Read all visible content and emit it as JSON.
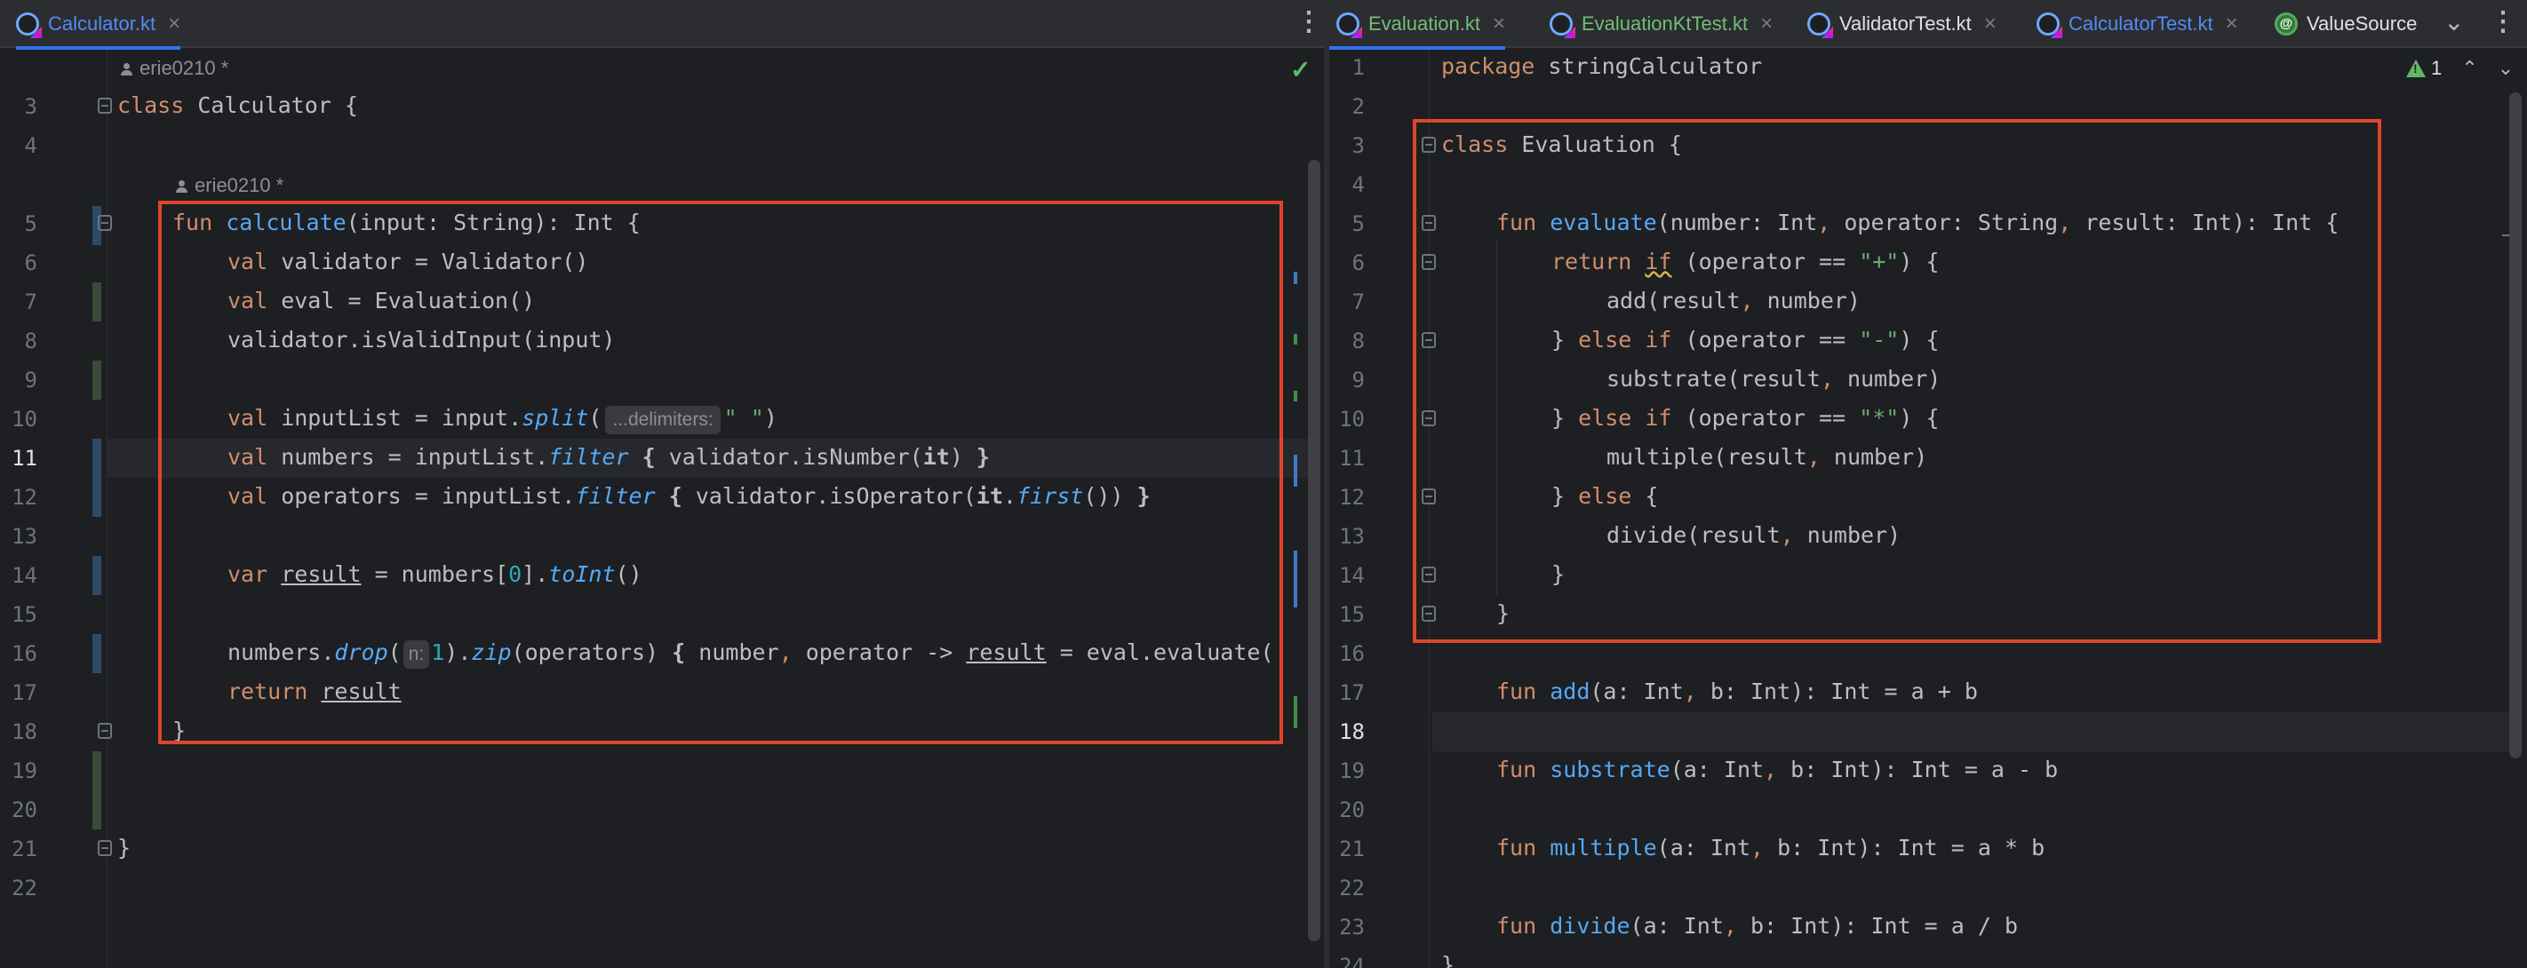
{
  "left": {
    "tabs": [
      {
        "label": "Calculator.kt",
        "icon": "kotlin-file-icon",
        "active": true
      }
    ],
    "author_top": "erie0210 *",
    "author_inline": "erie0210 *",
    "hint_delimiters": "...delimiters:",
    "hint_n": "n:",
    "line_numbers": [
      "3",
      "4",
      "5",
      "6",
      "7",
      "8",
      "9",
      "10",
      "11",
      "12",
      "13",
      "14",
      "15",
      "16",
      "17",
      "18",
      "19",
      "20",
      "21",
      "22"
    ],
    "colors": {
      "highlight_box": "#e0452c",
      "accent": "#3574f0"
    }
  },
  "right": {
    "tabs": [
      {
        "label": "Evaluation.kt",
        "icon": "kotlin-file-icon",
        "active": true
      },
      {
        "label": "EvaluationKtTest.kt",
        "icon": "kotlin-test-file-icon"
      },
      {
        "label": "ValidatorTest.kt",
        "icon": "kotlin-test-file-icon"
      },
      {
        "label": "CalculatorTest.kt",
        "icon": "kotlin-test-file-icon"
      },
      {
        "label": "ValueSource",
        "icon": "annotation-icon"
      }
    ],
    "inspection_count": "1",
    "line_numbers": [
      "1",
      "2",
      "3",
      "4",
      "5",
      "6",
      "7",
      "8",
      "9",
      "10",
      "11",
      "12",
      "13",
      "14",
      "15",
      "16",
      "17",
      "18",
      "19",
      "20",
      "21",
      "22",
      "23",
      "24"
    ]
  }
}
